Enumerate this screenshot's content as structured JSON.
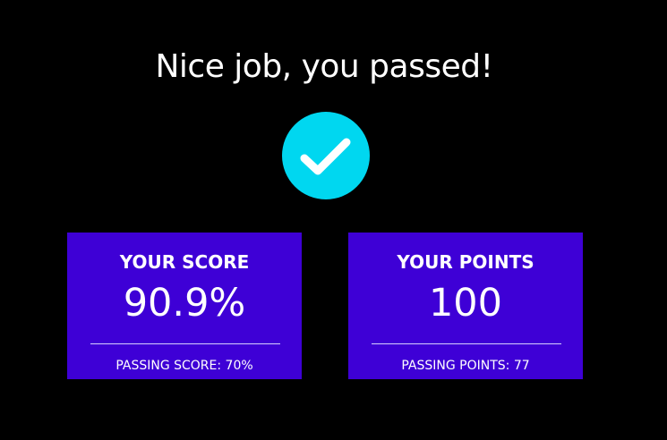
{
  "result": {
    "title": "Nice job, you passed!",
    "status_icon": "checkmark-icon",
    "colors": {
      "background": "#000000",
      "check_circle": "#00d7f0",
      "card": "#3e00d6",
      "text": "#ffffff"
    }
  },
  "score_card": {
    "label": "YOUR SCORE",
    "value": "90.9%",
    "passing_text": "PASSING SCORE: 70%"
  },
  "points_card": {
    "label": "YOUR POINTS",
    "value": "100",
    "passing_text": "PASSING POINTS: 77"
  }
}
